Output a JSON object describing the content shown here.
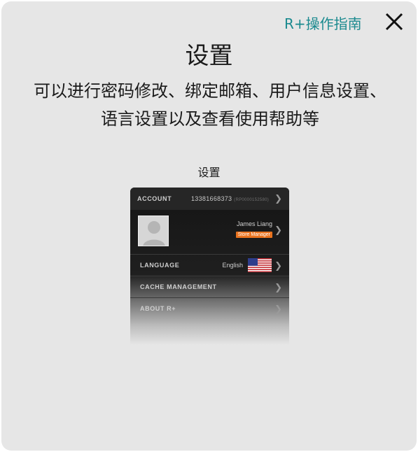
{
  "header": {
    "guide_link": "R+操作指南",
    "title": "设置",
    "description": "可以进行密码修改、绑定邮箱、用户信息设置、语言设置以及查看使用帮助等"
  },
  "preview": {
    "caption": "设置",
    "account": {
      "label": "ACCOUNT",
      "phone": "13381668373",
      "id": "(RP0000152580)"
    },
    "profile": {
      "name": "James Liang",
      "role": "Store Manager"
    },
    "language": {
      "label": "LANGUAGE",
      "value": "English"
    },
    "cache": {
      "label": "CACHE MANAGEMENT"
    },
    "about": {
      "label": "ABOUT R+"
    },
    "chevron": "❯"
  },
  "icons": {
    "close": "close-icon",
    "flag": "us-flag-icon",
    "avatar": "user-placeholder-icon"
  },
  "colors": {
    "accent": "#1b8a8f",
    "badge": "#e9731f",
    "panel": "#e6e6e6"
  }
}
